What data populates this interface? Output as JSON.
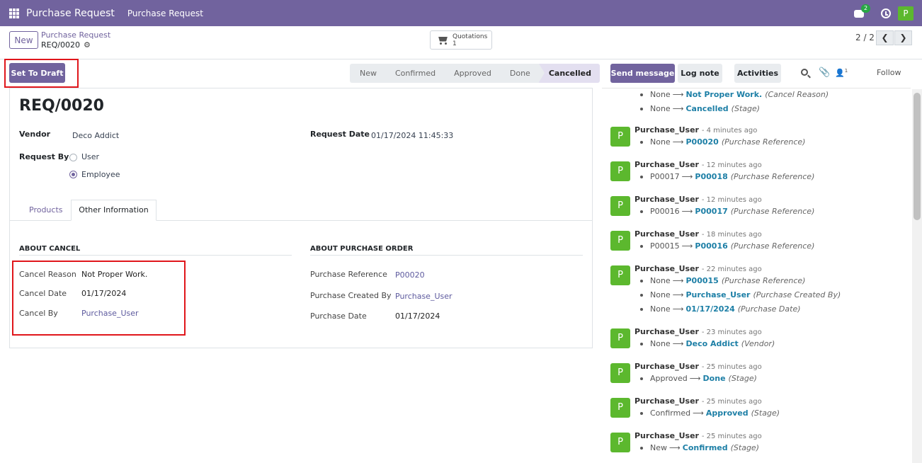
{
  "topbar": {
    "app_name": "Purchase Request",
    "menu_item": "Purchase Request",
    "chat_badge": "2",
    "user_initial": "P"
  },
  "control": {
    "new_label": "New",
    "breadcrumb_parent": "Purchase Request",
    "breadcrumb_current": "REQ/0020",
    "quotations_label": "Quotations",
    "quotations_count": "1",
    "pager": "2 / 2"
  },
  "actions": {
    "set_to_draft": "Set To Draft"
  },
  "statusbar": {
    "stages": [
      "New",
      "Confirmed",
      "Approved",
      "Done",
      "Cancelled"
    ],
    "active": "Cancelled"
  },
  "form": {
    "title": "REQ/0020",
    "vendor_label": "Vendor",
    "vendor_value": "Deco Addict",
    "request_date_label": "Request Date",
    "request_date_value": "01/17/2024 11:45:33",
    "request_by_label": "Request By",
    "request_by_options": [
      "User",
      "Employee"
    ],
    "request_by_selected": "Employee",
    "tabs": [
      "Products",
      "Other Information"
    ],
    "active_tab": "Other Information",
    "about_cancel": {
      "heading": "ABOUT CANCEL",
      "cancel_reason_label": "Cancel Reason",
      "cancel_reason_value": "Not Proper Work.",
      "cancel_date_label": "Cancel Date",
      "cancel_date_value": "01/17/2024",
      "cancel_by_label": "Cancel By",
      "cancel_by_value": "Purchase_User"
    },
    "about_po": {
      "heading": "ABOUT PURCHASE ORDER",
      "reference_label": "Purchase Reference",
      "reference_value": "P00020",
      "created_by_label": "Purchase Created By",
      "created_by_value": "Purchase_User",
      "date_label": "Purchase Date",
      "date_value": "01/17/2024"
    }
  },
  "chatter": {
    "send_message": "Send message",
    "log_note": "Log note",
    "activities": "Activities",
    "followers_count": "1",
    "follow": "Follow",
    "top_changes": [
      {
        "old": "None",
        "new": "Not Proper Work.",
        "field": "(Cancel Reason)"
      },
      {
        "old": "None",
        "new": "Cancelled",
        "field": "(Stage)"
      }
    ],
    "messages": [
      {
        "initial": "P",
        "author": "Purchase_User",
        "time": "- 4 minutes ago",
        "changes": [
          {
            "old": "None",
            "new": "P00020",
            "field": "(Purchase Reference)"
          }
        ]
      },
      {
        "initial": "P",
        "author": "Purchase_User",
        "time": "- 12 minutes ago",
        "changes": [
          {
            "old": "P00017",
            "new": "P00018",
            "field": "(Purchase Reference)"
          }
        ]
      },
      {
        "initial": "P",
        "author": "Purchase_User",
        "time": "- 12 minutes ago",
        "changes": [
          {
            "old": "P00016",
            "new": "P00017",
            "field": "(Purchase Reference)"
          }
        ]
      },
      {
        "initial": "P",
        "author": "Purchase_User",
        "time": "- 18 minutes ago",
        "changes": [
          {
            "old": "P00015",
            "new": "P00016",
            "field": "(Purchase Reference)"
          }
        ]
      },
      {
        "initial": "P",
        "author": "Purchase_User",
        "time": "- 22 minutes ago",
        "changes": [
          {
            "old": "None",
            "new": "P00015",
            "field": "(Purchase Reference)"
          },
          {
            "old": "None",
            "new": "Purchase_User",
            "field": "(Purchase Created By)"
          },
          {
            "old": "None",
            "new": "01/17/2024",
            "field": "(Purchase Date)"
          }
        ]
      },
      {
        "initial": "P",
        "author": "Purchase_User",
        "time": "- 23 minutes ago",
        "changes": [
          {
            "old": "None",
            "new": "Deco Addict",
            "field": "(Vendor)"
          }
        ]
      },
      {
        "initial": "P",
        "author": "Purchase_User",
        "time": "- 25 minutes ago",
        "changes": [
          {
            "old": "Approved",
            "new": "Done",
            "field": "(Stage)"
          }
        ]
      },
      {
        "initial": "P",
        "author": "Purchase_User",
        "time": "- 25 minutes ago",
        "changes": [
          {
            "old": "Confirmed",
            "new": "Approved",
            "field": "(Stage)"
          }
        ]
      },
      {
        "initial": "P",
        "author": "Purchase_User",
        "time": "- 25 minutes ago",
        "changes": [
          {
            "old": "New",
            "new": "Confirmed",
            "field": "(Stage)"
          }
        ]
      }
    ]
  },
  "colors": {
    "brand": "#71639e",
    "avatar": "#5cb82e",
    "highlight": "#e0161b",
    "link": "#1d7fa6"
  }
}
